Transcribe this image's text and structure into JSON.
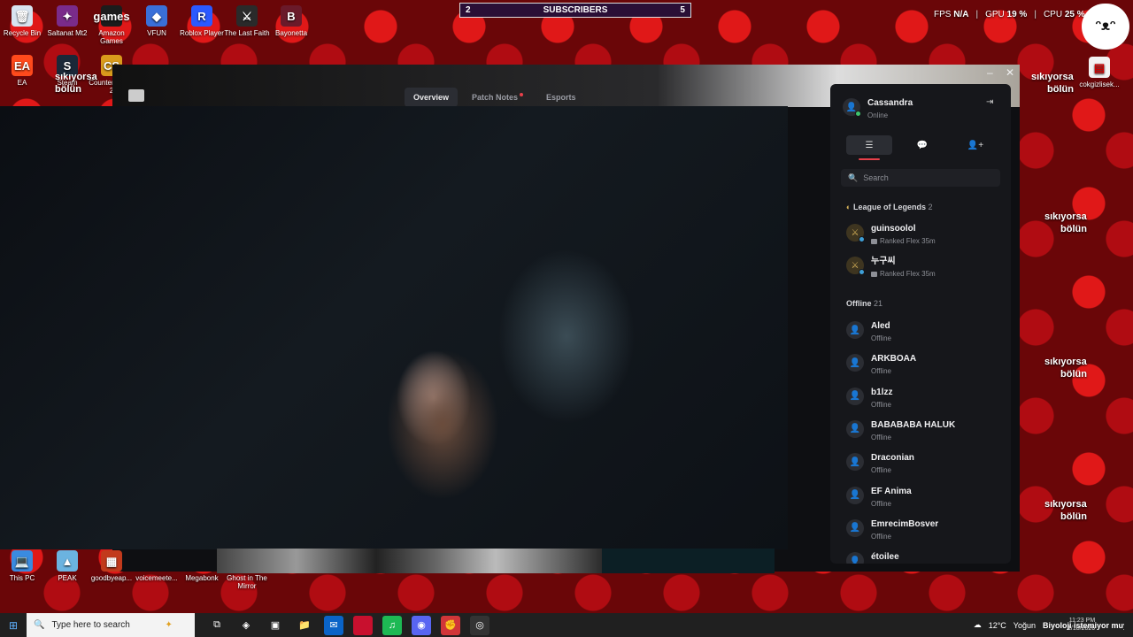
{
  "desktop": {
    "top_icons": [
      {
        "label": "Recycle Bin",
        "glyph": "🗑",
        "color": "#d8e4f0"
      },
      {
        "label": "Saltanat Mt2",
        "glyph": "✦",
        "color": "#7a2b8a"
      },
      {
        "label": "Amazon Games",
        "glyph": "games",
        "color": "#1c1c1c"
      },
      {
        "label": "VFUN",
        "glyph": "◆",
        "color": "#3a6fd8"
      },
      {
        "label": "Roblox Player",
        "glyph": "R",
        "color": "#2b59ff"
      },
      {
        "label": "The Last Faith",
        "glyph": "⚔",
        "color": "#2a2a2a"
      },
      {
        "label": "Bayonetta",
        "glyph": "B",
        "color": "#6a1a2a"
      }
    ],
    "second_icons": [
      {
        "label": "EA",
        "glyph": "EA",
        "color": "#ff4a1c"
      },
      {
        "label": "Steam",
        "glyph": "S",
        "color": "#1b2838"
      },
      {
        "label": "Counter-Strike 2",
        "glyph": "CS",
        "color": "#d99b1c"
      }
    ],
    "right_icon": {
      "label": "cokgizlisek...",
      "glyph": "📄",
      "color": "#f3f3f3"
    },
    "bottom_icons": [
      {
        "label": "This PC",
        "glyph": "💻",
        "color": "#3a8be0"
      },
      {
        "label": "PEAK",
        "glyph": "▲",
        "color": "#6bb3e0"
      },
      {
        "label": "goodbyeap...",
        "glyph": "▦",
        "color": "#c23a1c"
      },
      {
        "label": "voicemeete...",
        "glyph": "",
        "color": "transparent"
      },
      {
        "label": "Megabonk",
        "glyph": "",
        "color": "transparent"
      },
      {
        "label": "Ghost in The Mirror",
        "glyph": "",
        "color": "transparent"
      }
    ],
    "wall_texts": [
      "sıkıyorsa",
      "bölün"
    ]
  },
  "overlay": {
    "fps_label": "FPS",
    "fps_value": "N/A",
    "gpu_label": "GPU",
    "gpu_value": "19 %",
    "cpu_label": "CPU",
    "cpu_value": "25 %",
    "subscribers_left": "2",
    "subscribers_label": "SUBSCRIBERS",
    "subscribers_right": "5"
  },
  "client": {
    "tabs": [
      {
        "label": "Overview",
        "active": true
      },
      {
        "label": "Patch Notes",
        "notify": true
      },
      {
        "label": "Esports"
      }
    ],
    "minimize": "–",
    "close": "✕"
  },
  "friends": {
    "me": {
      "name": "Cassandra",
      "status": "Online",
      "status_color": "#3ec46d"
    },
    "collapse_icon": "⇥",
    "panel_tabs": [
      "☰",
      "💬",
      "👤+"
    ],
    "search_placeholder": "Search",
    "group_game": {
      "title": "League of Legends",
      "count": "2"
    },
    "in_game": [
      {
        "name": "guinsoolol",
        "activity": "Ranked Flex 35m"
      },
      {
        "name": "누구씨",
        "activity": "Ranked Flex 35m"
      }
    ],
    "group_offline": {
      "title": "Offline",
      "count": "21"
    },
    "offline": [
      {
        "name": "Aled",
        "status": "Offline"
      },
      {
        "name": "ARKBOAA",
        "status": "Offline"
      },
      {
        "name": "b1lzz",
        "status": "Offline"
      },
      {
        "name": "BABABABA HALUK",
        "status": "Offline"
      },
      {
        "name": "Draconian",
        "status": "Offline"
      },
      {
        "name": "EF Anima",
        "status": "Offline"
      },
      {
        "name": "EmrecimBosver",
        "status": "Offline"
      },
      {
        "name": "étoilee",
        "status": ""
      }
    ]
  },
  "taskbar": {
    "search_placeholder": "Type here to search",
    "apps": [
      {
        "name": "task-view",
        "glyph": "⧉",
        "color": "transparent"
      },
      {
        "name": "copilot",
        "glyph": "◈",
        "color": "transparent"
      },
      {
        "name": "store",
        "glyph": "▣",
        "color": "transparent"
      },
      {
        "name": "explorer",
        "glyph": "📁",
        "color": "transparent"
      },
      {
        "name": "outlook",
        "glyph": "✉",
        "color": "#0a64c8"
      },
      {
        "name": "red-app",
        "glyph": "",
        "color": "#c8102e"
      },
      {
        "name": "spotify",
        "glyph": "♫",
        "color": "#1db954"
      },
      {
        "name": "discord",
        "glyph": "◉",
        "color": "#5865f2"
      },
      {
        "name": "riot",
        "glyph": "✊",
        "color": "#d13639"
      },
      {
        "name": "obs",
        "glyph": "◎",
        "color": "#333"
      }
    ],
    "weather_temp": "12°C",
    "weather_text": "Yoğun",
    "ticker": "Biyoloji istemiyor muydun",
    "time": "11:23 PM",
    "date": "1/18/2026"
  }
}
